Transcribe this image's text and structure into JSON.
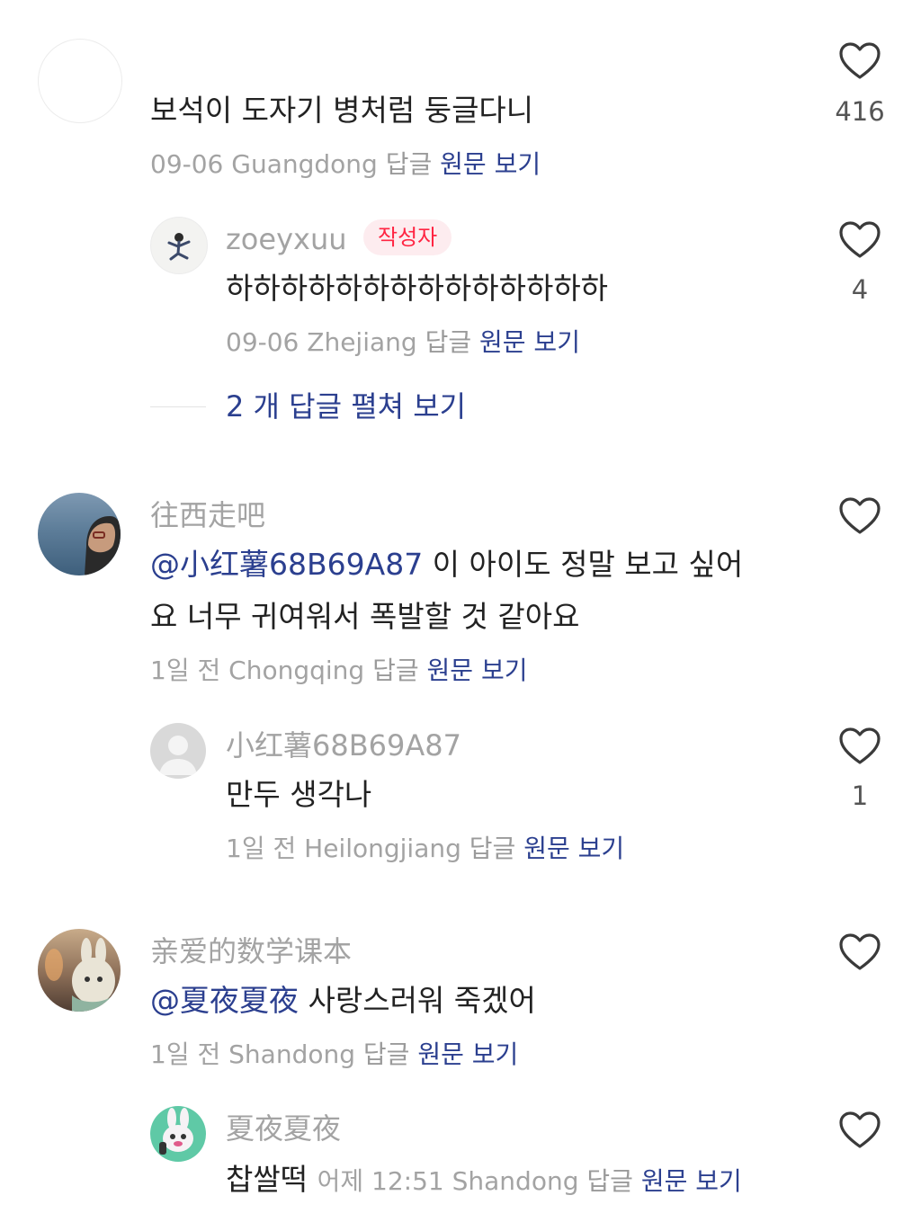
{
  "comments": [
    {
      "text": "보석이 도자기 병처럼 둥글다니",
      "date": "09-06",
      "location": "Guangdong",
      "reply_label": "답글",
      "original_label": "원문 보기",
      "likes": "416",
      "icon": "heart-outline-icon",
      "replies": [
        {
          "username": "zoeyxuu",
          "badge": "작성자",
          "text": "하하하하하하하하하하하하하하",
          "date": "09-06",
          "location": "Zhejiang",
          "reply_label": "답글",
          "original_label": "원문 보기",
          "likes": "4"
        }
      ],
      "expand_label": "2 개 답글 펼쳐 보기"
    },
    {
      "username": "往西走吧",
      "mention": "@小红薯68B69A87",
      "text_line1": " 이 아이도 정말 보고 싶어",
      "text_line2": "요 너무 귀여워서 폭발할 것 같아요",
      "date": "1일 전",
      "location": "Chongqing",
      "reply_label": "답글",
      "original_label": "원문 보기",
      "likes": "",
      "replies": [
        {
          "username": "小红薯68B69A87",
          "text": "만두 생각나",
          "date": "1일 전",
          "location": "Heilongjiang",
          "reply_label": "답글",
          "original_label": "원문 보기",
          "likes": "1"
        }
      ]
    },
    {
      "username": "亲爱的数学课本",
      "mention": "@夏夜夏夜",
      "text": " 사랑스러워 죽겠어",
      "date": "1일 전",
      "location": "Shandong",
      "reply_label": "답글",
      "original_label": "원문 보기",
      "likes": "",
      "replies": [
        {
          "username": "夏夜夏夜",
          "text": "찹쌀떡",
          "date": "어제 12:51",
          "location": "Shandong",
          "reply_label": "답글",
          "original_label": "원문 보기",
          "likes": ""
        }
      ]
    }
  ],
  "colors": {
    "link": "#2b3f8f",
    "meta": "#a3a3a3",
    "badge_text": "#ff2442",
    "badge_bg": "#fdecef"
  }
}
